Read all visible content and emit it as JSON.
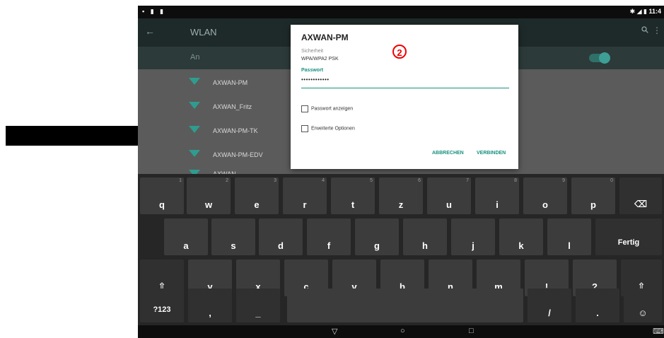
{
  "statusbar": {
    "left_icons": "▪ ▮ ▮",
    "right_text": "✱ ◢ ▮ 11:4"
  },
  "appbar": {
    "back_icon": "←",
    "title": "WLAN",
    "search_icon": "🔍",
    "more_icon": "⋮"
  },
  "wlan_switch": {
    "label": "An",
    "state": "on"
  },
  "networks": [
    {
      "name": "AXWAN-PM"
    },
    {
      "name": "AXWAN_Fritz"
    },
    {
      "name": "AXWAN-PM-TK"
    },
    {
      "name": "AXWAN-PM-EDV"
    },
    {
      "name": "AXWAN"
    }
  ],
  "dialog": {
    "title": "AXWAN-PM",
    "security_label": "Sicherheit",
    "security_value": "WPA/WPA2 PSK",
    "password_label": "Passwort",
    "password_value": "••••••••••••",
    "show_password_label": "Passwort anzeigen",
    "advanced_options_label": "Erweiterte Optionen",
    "cancel_label": "ABBRECHEN",
    "connect_label": "VERBINDEN"
  },
  "step_marker": "2",
  "keyboard": {
    "row1": [
      {
        "label": "q",
        "hint": "1"
      },
      {
        "label": "w",
        "hint": "2"
      },
      {
        "label": "e",
        "hint": "3"
      },
      {
        "label": "r",
        "hint": "4"
      },
      {
        "label": "t",
        "hint": "5"
      },
      {
        "label": "z",
        "hint": "6"
      },
      {
        "label": "u",
        "hint": "7"
      },
      {
        "label": "i",
        "hint": "8"
      },
      {
        "label": "o",
        "hint": "9"
      },
      {
        "label": "p",
        "hint": "0"
      }
    ],
    "backspace": "⌫",
    "row2": [
      "a",
      "s",
      "d",
      "f",
      "g",
      "h",
      "j",
      "k",
      "l"
    ],
    "done": "Fertig",
    "shift": "⇧",
    "row3": [
      "y",
      "x",
      "c",
      "v",
      "b",
      "n",
      "m",
      "!",
      "?"
    ],
    "symbols": "?123",
    "comma": ",",
    "dash": "_",
    "slash": "/",
    "period": ".",
    "emoji": "☺"
  },
  "navbar": {
    "back": "▽",
    "home": "○",
    "recents": "□",
    "keyboard_switch": "⌨"
  }
}
